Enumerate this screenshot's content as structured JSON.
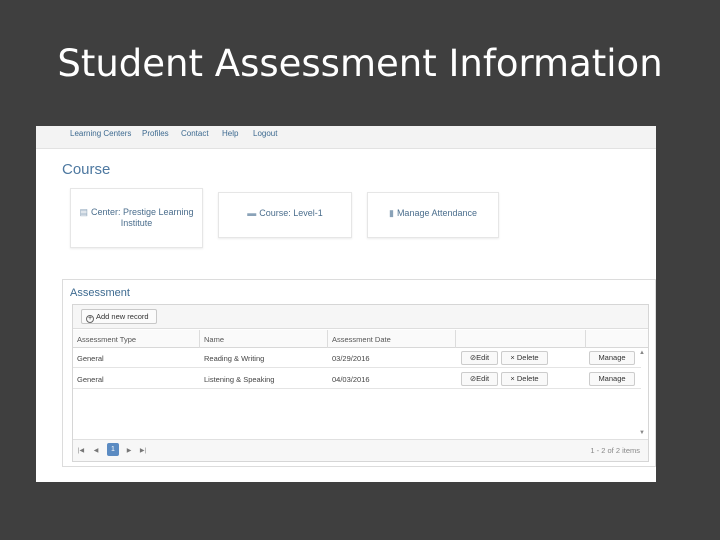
{
  "slide": {
    "title": "Student Assessment Information"
  },
  "nav": {
    "items": [
      "Learning Centers",
      "Profiles",
      "Contact",
      "Help",
      "Logout"
    ]
  },
  "course": {
    "heading": "Course",
    "cards": [
      {
        "label_line1": "Center: Prestige Learning",
        "label_line2": "Institute",
        "icon": "building-icon"
      },
      {
        "label": "Course: Level-1",
        "icon": "book-icon"
      },
      {
        "label": "Manage Attendance",
        "icon": "bookmark-icon"
      }
    ]
  },
  "assessment": {
    "title": "Assessment",
    "add_label": "Add new record",
    "columns": [
      "Assessment Type",
      "Name",
      "Assessment Date"
    ],
    "rows": [
      {
        "type": "General",
        "name": "Reading & Writing",
        "date": "03/29/2016"
      },
      {
        "type": "General",
        "name": "Listening & Speaking",
        "date": "04/03/2016"
      }
    ],
    "edit_label": "Edit",
    "delete_label": "Delete",
    "manage_label": "Manage",
    "pager": {
      "current_page": "1",
      "info": "1 - 2 of 2 items"
    }
  }
}
